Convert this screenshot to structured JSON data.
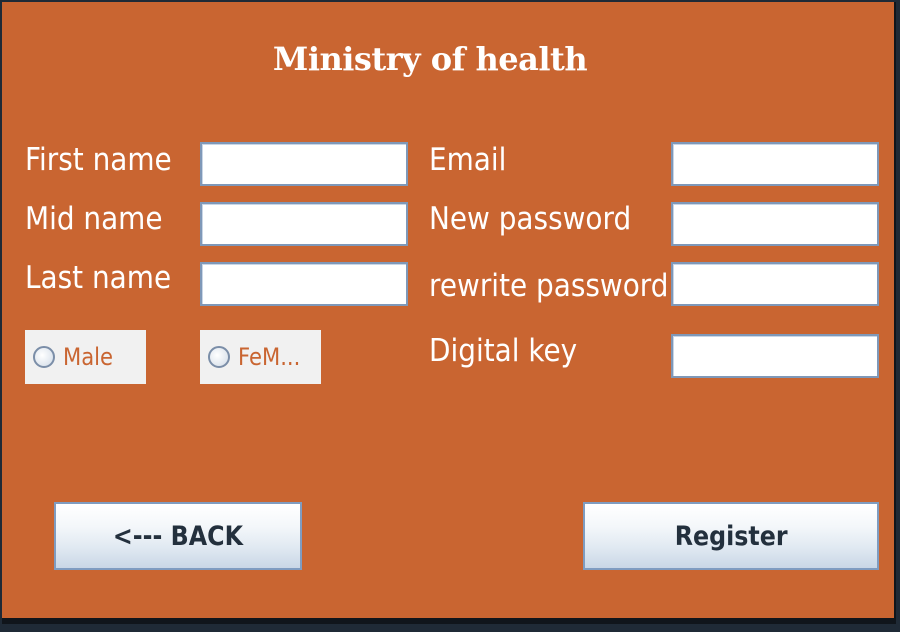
{
  "window": {
    "title": "Ministry of health",
    "background": "#c96531"
  },
  "form": {
    "first_name_label": "First name",
    "mid_name_label": "Mid name",
    "last_name_label": "Last name",
    "email_label": "Email",
    "new_password_label": "New password",
    "rewrite_password_label": "rewrite password",
    "digital_key_label": "Digital key",
    "first_name_value": "",
    "mid_name_value": "",
    "last_name_value": "",
    "email_value": "",
    "new_password_value": "",
    "rewrite_password_value": "",
    "digital_key_value": ""
  },
  "gender": {
    "male_label": "Male",
    "female_label": "FeM..."
  },
  "buttons": {
    "back_label": "<--- BACK",
    "register_label": "Register"
  }
}
